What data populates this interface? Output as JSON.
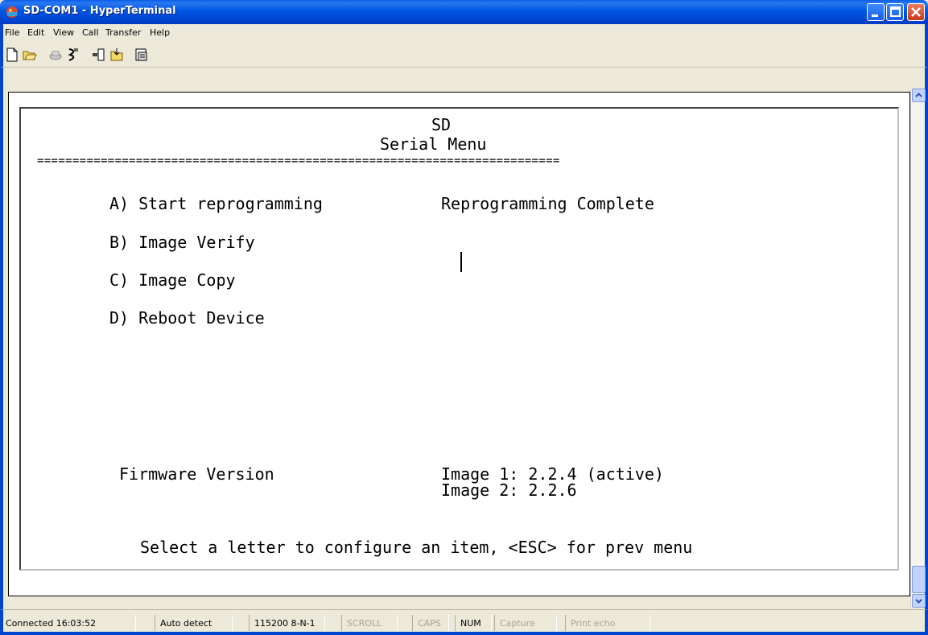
{
  "window": {
    "title": "SD-COM1 - HyperTerminal"
  },
  "menubar": {
    "items": [
      "File",
      "Edit",
      "View",
      "Call",
      "Transfer",
      "Help"
    ]
  },
  "toolbar": {
    "icons": [
      "new-icon",
      "open-icon",
      "connect-icon",
      "disconnect-icon",
      "send-icon",
      "receive-icon",
      "properties-icon"
    ]
  },
  "terminal": {
    "header_line1": "SD",
    "header_line2": "Serial Menu",
    "rule": "==========================================================================",
    "options": [
      {
        "label": "A) Start reprogramming"
      },
      {
        "label": "B) Image Verify"
      },
      {
        "label": "C) Image Copy"
      },
      {
        "label": "D) Reboot Device"
      }
    ],
    "status_message": "Reprogramming Complete",
    "firmware_label": "Firmware Version",
    "image1": "Image 1: 2.2.4 (active)",
    "image2": "Image 2: 2.2.6",
    "prompt": "Select a letter to configure an item, <ESC> for prev menu"
  },
  "statusbar": {
    "connected": "Connected 16:03:52",
    "detect": "Auto detect",
    "port": "115200 8-N-1",
    "scroll": "SCROLL",
    "caps": "CAPS",
    "num": "NUM",
    "capture": "Capture",
    "print_echo": "Print echo"
  }
}
